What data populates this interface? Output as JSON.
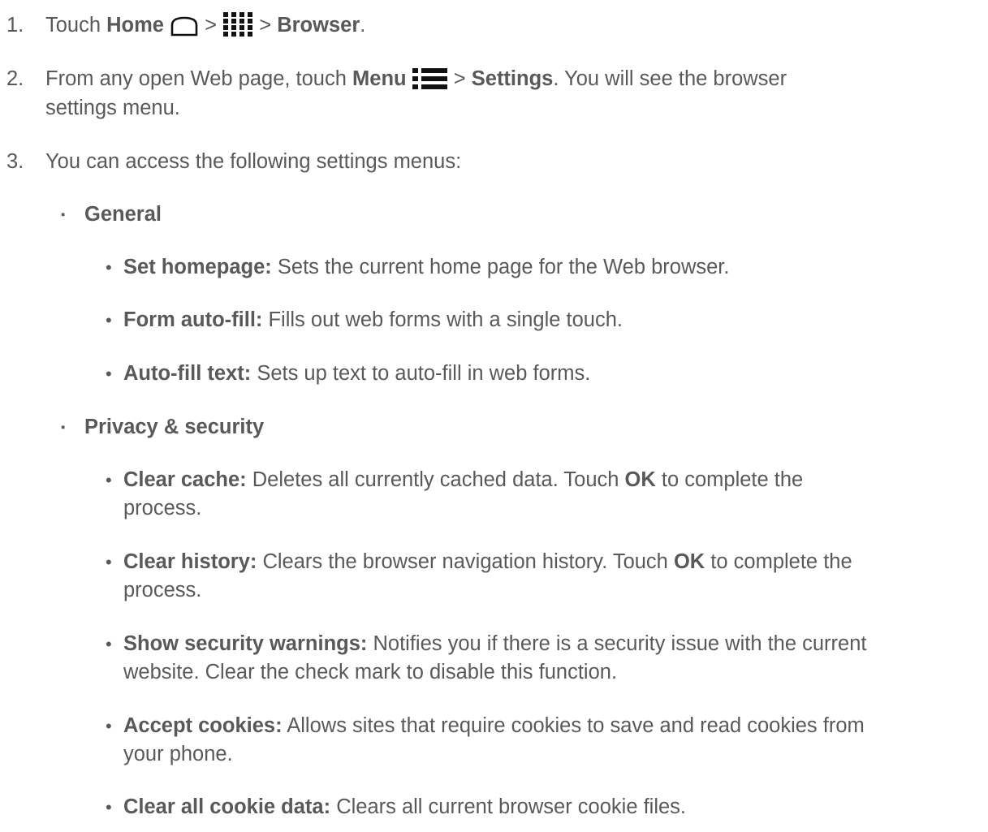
{
  "steps": [
    {
      "num": "1.",
      "touch": "Touch ",
      "home": "Home",
      "sep1": " > ",
      "sep2": " > ",
      "browser": "Browser",
      "end": "."
    },
    {
      "num": "2.",
      "pre": "From any open Web page, touch ",
      "menu": "Menu",
      "sep": " > ",
      "settings": "Settings",
      "post": ". You will see the browser",
      "line2": "settings menu."
    },
    {
      "num": "3.",
      "text": "You can access the following settings menus:"
    }
  ],
  "general": {
    "bullet": "▪",
    "title": "General",
    "items": [
      {
        "bullet": "•",
        "term": "Set homepage:",
        "desc": " Sets the current home page for the Web browser."
      },
      {
        "bullet": "•",
        "term": "Form auto-fill:",
        "desc": " Fills out web forms with a single touch."
      },
      {
        "bullet": "•",
        "term": "Auto-fill text:",
        "desc": " Sets up text to auto-fill in web forms."
      }
    ]
  },
  "privacy": {
    "bullet": "▪",
    "title": "Privacy & security",
    "items": [
      {
        "bullet": "•",
        "term": "Clear cache:",
        "desc": " Deletes all currently cached data. Touch ",
        "ok": "OK",
        "desc2": " to complete the",
        "line2": "process."
      },
      {
        "bullet": "•",
        "term": "Clear history:",
        "desc": " Clears the browser navigation history. Touch ",
        "ok": "OK",
        "desc2": " to complete the",
        "line2": "process."
      },
      {
        "bullet": "•",
        "term": "Show security warnings:",
        "desc": " Notifies you if there is a security issue with the current",
        "line2": "website. Clear the check mark to disable this function."
      },
      {
        "bullet": "•",
        "term": "Accept cookies:",
        "desc": " Allows sites that require cookies to save and read cookies from",
        "line2": "your phone."
      },
      {
        "bullet": "•",
        "term": "Clear all cookie data:",
        "desc": " Clears all current browser cookie files."
      }
    ]
  },
  "icons": [
    "home-icon",
    "apps-grid-icon",
    "menu-icon"
  ]
}
